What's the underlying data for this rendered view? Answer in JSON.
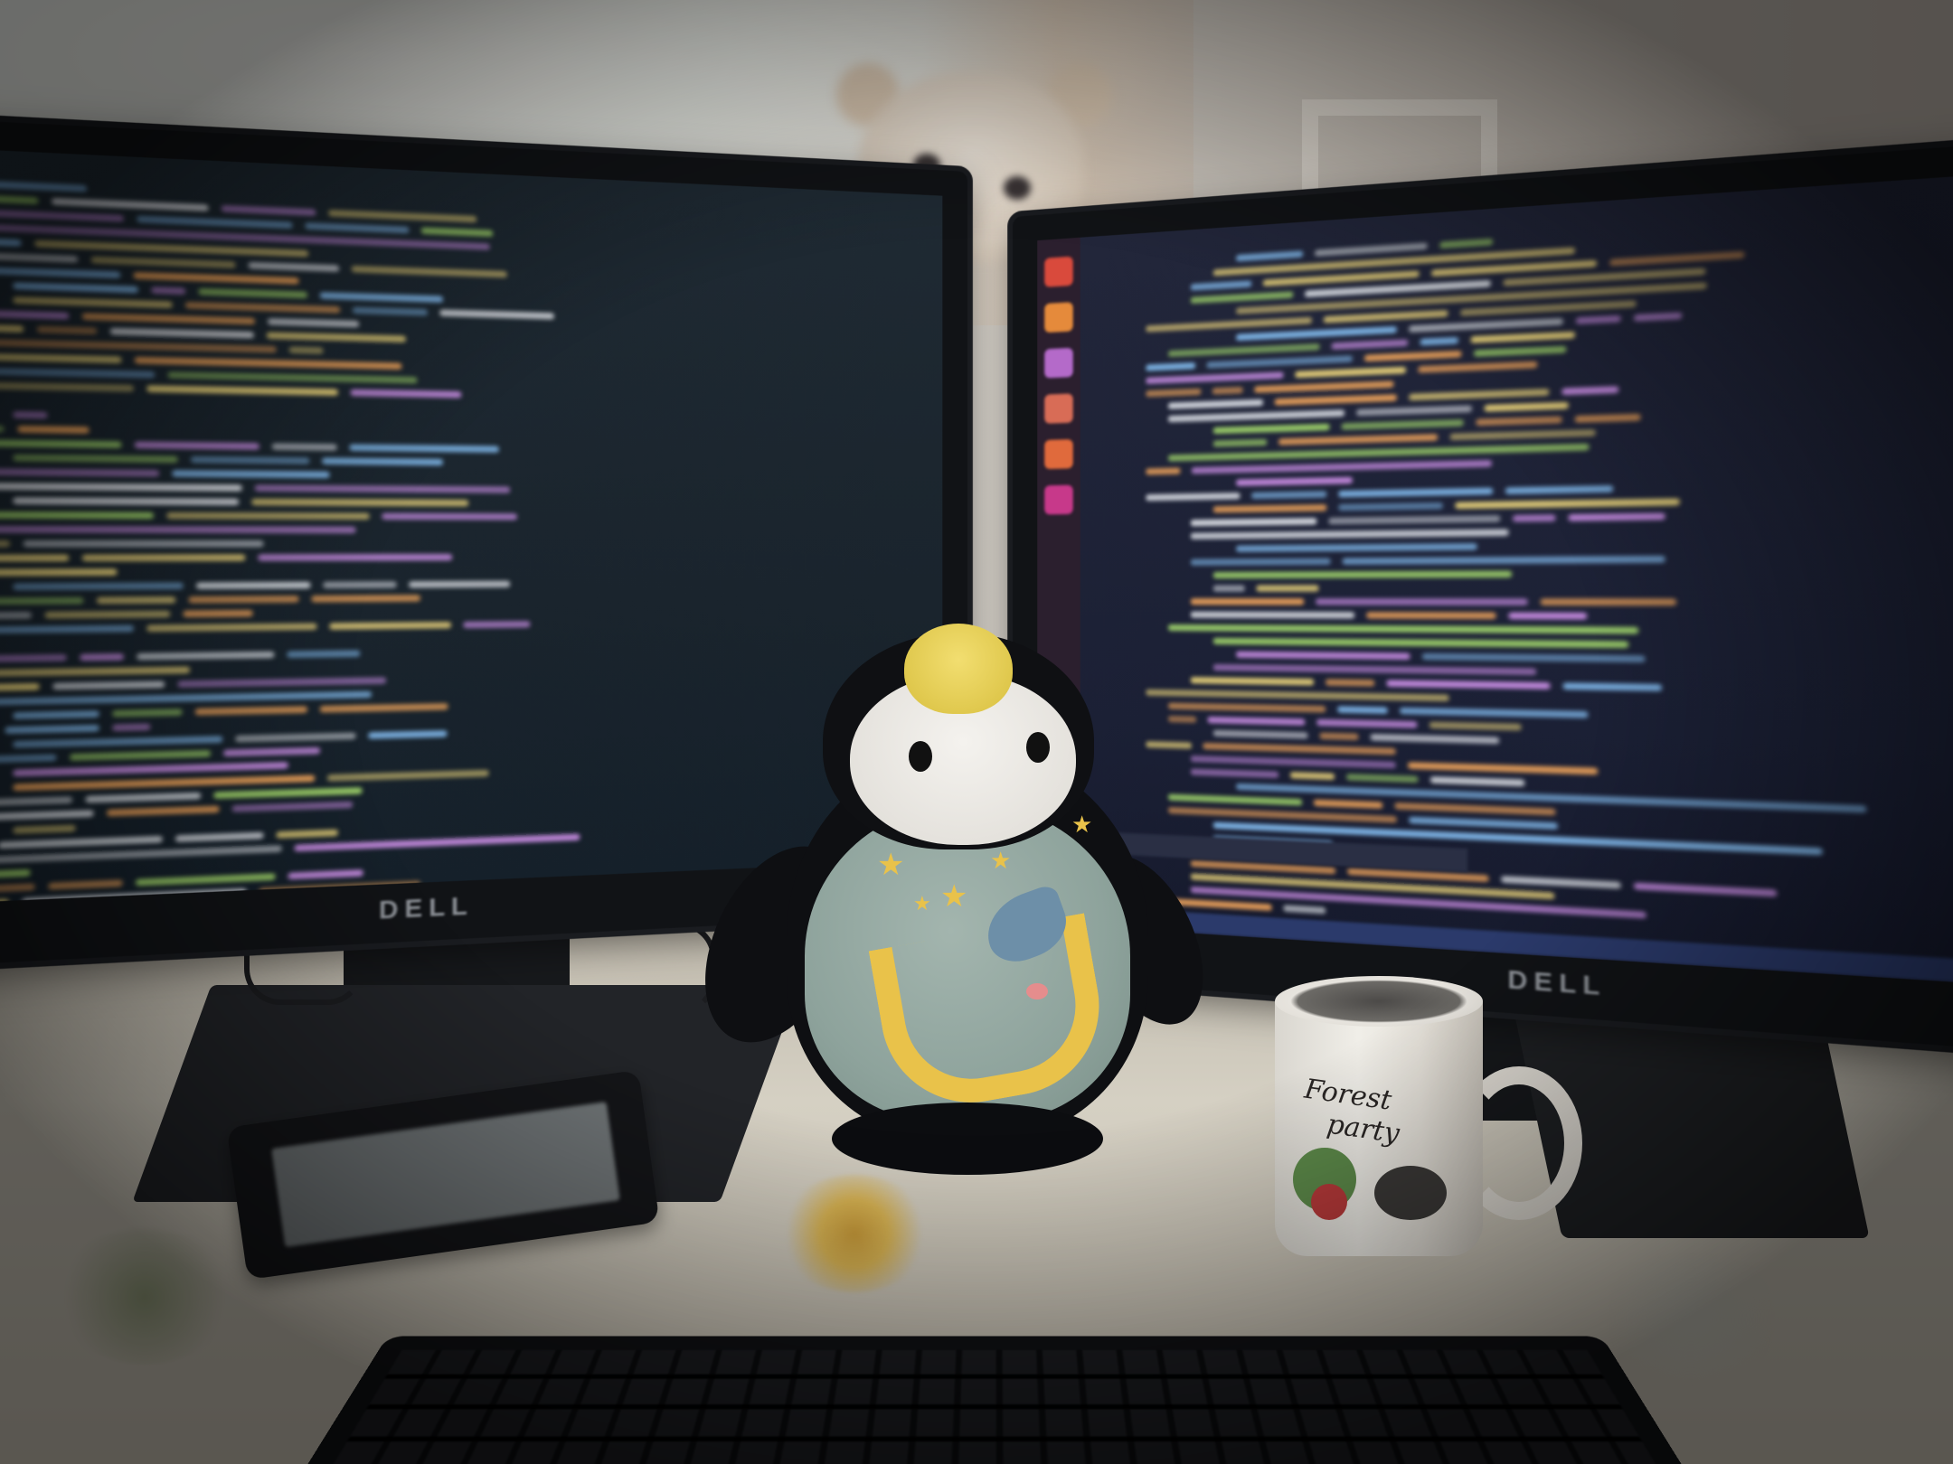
{
  "scene": {
    "left_monitor": {
      "brand": "DELL"
    },
    "right_monitor": {
      "brand": "DELL"
    },
    "mug": {
      "text_line1": "Forest",
      "text_line2": "party"
    }
  },
  "colors": {
    "code_green": "#9fd36b",
    "code_blue": "#7fb6e8",
    "code_yellow": "#e8d17a",
    "code_orange": "#e9a05a",
    "code_white": "#d9dde3",
    "code_purple": "#c58be0",
    "moon_yellow": "#e9c24a",
    "plush_blue": "#8ea39c"
  }
}
